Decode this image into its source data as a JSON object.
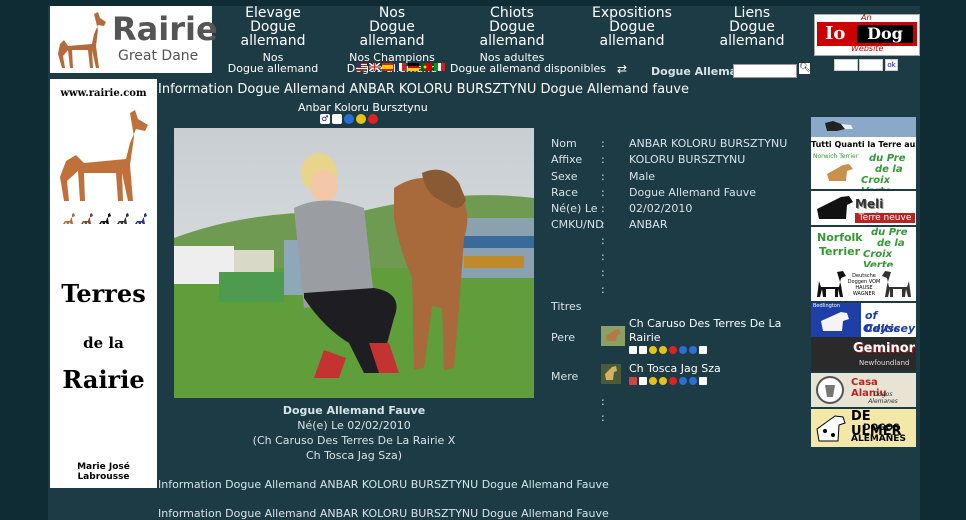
{
  "header": {
    "logo_title": "Rairie",
    "logo_subtitle": "Great Dane",
    "nav": [
      {
        "line1": "Elevage",
        "line2": "Dogue allemand",
        "sub1": "Nos",
        "sub2": "Dogue allemand"
      },
      {
        "line1": "Nos",
        "line2": "Dogue allemand",
        "sub1": "Nos Champions",
        "sub2": "Dogue allemand"
      },
      {
        "line1": "Chiots",
        "line2": "Dogue allemand",
        "sub1": "Nos adultes",
        "sub2": "Dogue allemand disponibles"
      },
      {
        "line1": "Expositions",
        "line2": "Dogue allemand"
      },
      {
        "line1": "Liens",
        "line2": "Dogue allemand"
      }
    ],
    "search_label": "Dogue Allemand:",
    "search_value": "",
    "iodog": {
      "an": "An",
      "io": "Io",
      "dog": "Dog",
      "website": "Website"
    },
    "flags": [
      "us",
      "uk",
      "es",
      "fr",
      "de",
      "pt",
      "it"
    ]
  },
  "left_panel": {
    "url": "www.rairie.com",
    "terres": "Terres",
    "de_la": "de la",
    "rairie": "Rairie",
    "owner": "Marie José Labrousse"
  },
  "main": {
    "title": "Information Dogue Allemand ANBAR KOLORU BURSZTYNU Dogue Allemand fauve",
    "subtitle": "Anbar Koloru Bursztynu",
    "caption_title": "Dogue Allemand Fauve",
    "caption_birth": "Né(e) Le 02/02/2010",
    "caption_parents1": "(Ch Caruso Des Terres De La Rairie X",
    "caption_parents2": "Ch Tosca Jag Sza)",
    "info": [
      {
        "key": "Nom",
        "value": "ANBAR KOLORU BURSZTYNU"
      },
      {
        "key": "Affixe",
        "value": "KOLORU BURSZTYNU"
      },
      {
        "key": "Sexe",
        "value": "Male"
      },
      {
        "key": "Race",
        "value": "Dogue Allemand Fauve"
      },
      {
        "key": "Né(e) Le",
        "value": "02/02/2010"
      },
      {
        "key": "CMKU/ND",
        "value": "ANBAR"
      }
    ],
    "colon": ":",
    "titres_label": "Titres",
    "pere_label": "Pere",
    "pere_name_1": "Ch Caruso Des Terres De La",
    "pere_name_2": "Rairie",
    "mere_label": "Mere",
    "mere_name": "Ch Tosca Jag Sza",
    "footer1": "Information Dogue Allemand ANBAR KOLORU BURSZTYNU Dogue Allemand Fauve",
    "footer2": "Information Dogue Allemand ANBAR KOLORU BURSZTYNU Dogue Allemand Fauve"
  },
  "ads": {
    "tutti": "Tutti Quanti la Terre aux Loups",
    "norwich": "Norwich Terrier",
    "du_pre": "du Pre",
    "de_la": "de la",
    "croix_verte": "Croix Verte",
    "meli_melo": "Meli Melo",
    "terre_neuve": "Terre neuve",
    "norfolk": "Norfolk",
    "terrier": "Terrier",
    "deutsche": "Deutsche Doggen VOM HAUSE WAGNER",
    "bedlington": "Bedlington",
    "of_celtic": "of Celtic",
    "odyssey": "Odyssey",
    "geminorum": "Geminorum",
    "newfoundland": "Newfoundland",
    "casa": "Casa Alaniu",
    "dogos": "Dogos Alemanes",
    "de_ulmer": "DE ULMER",
    "dogos2": "DOGOS",
    "alemanes": "ALEMANES"
  }
}
